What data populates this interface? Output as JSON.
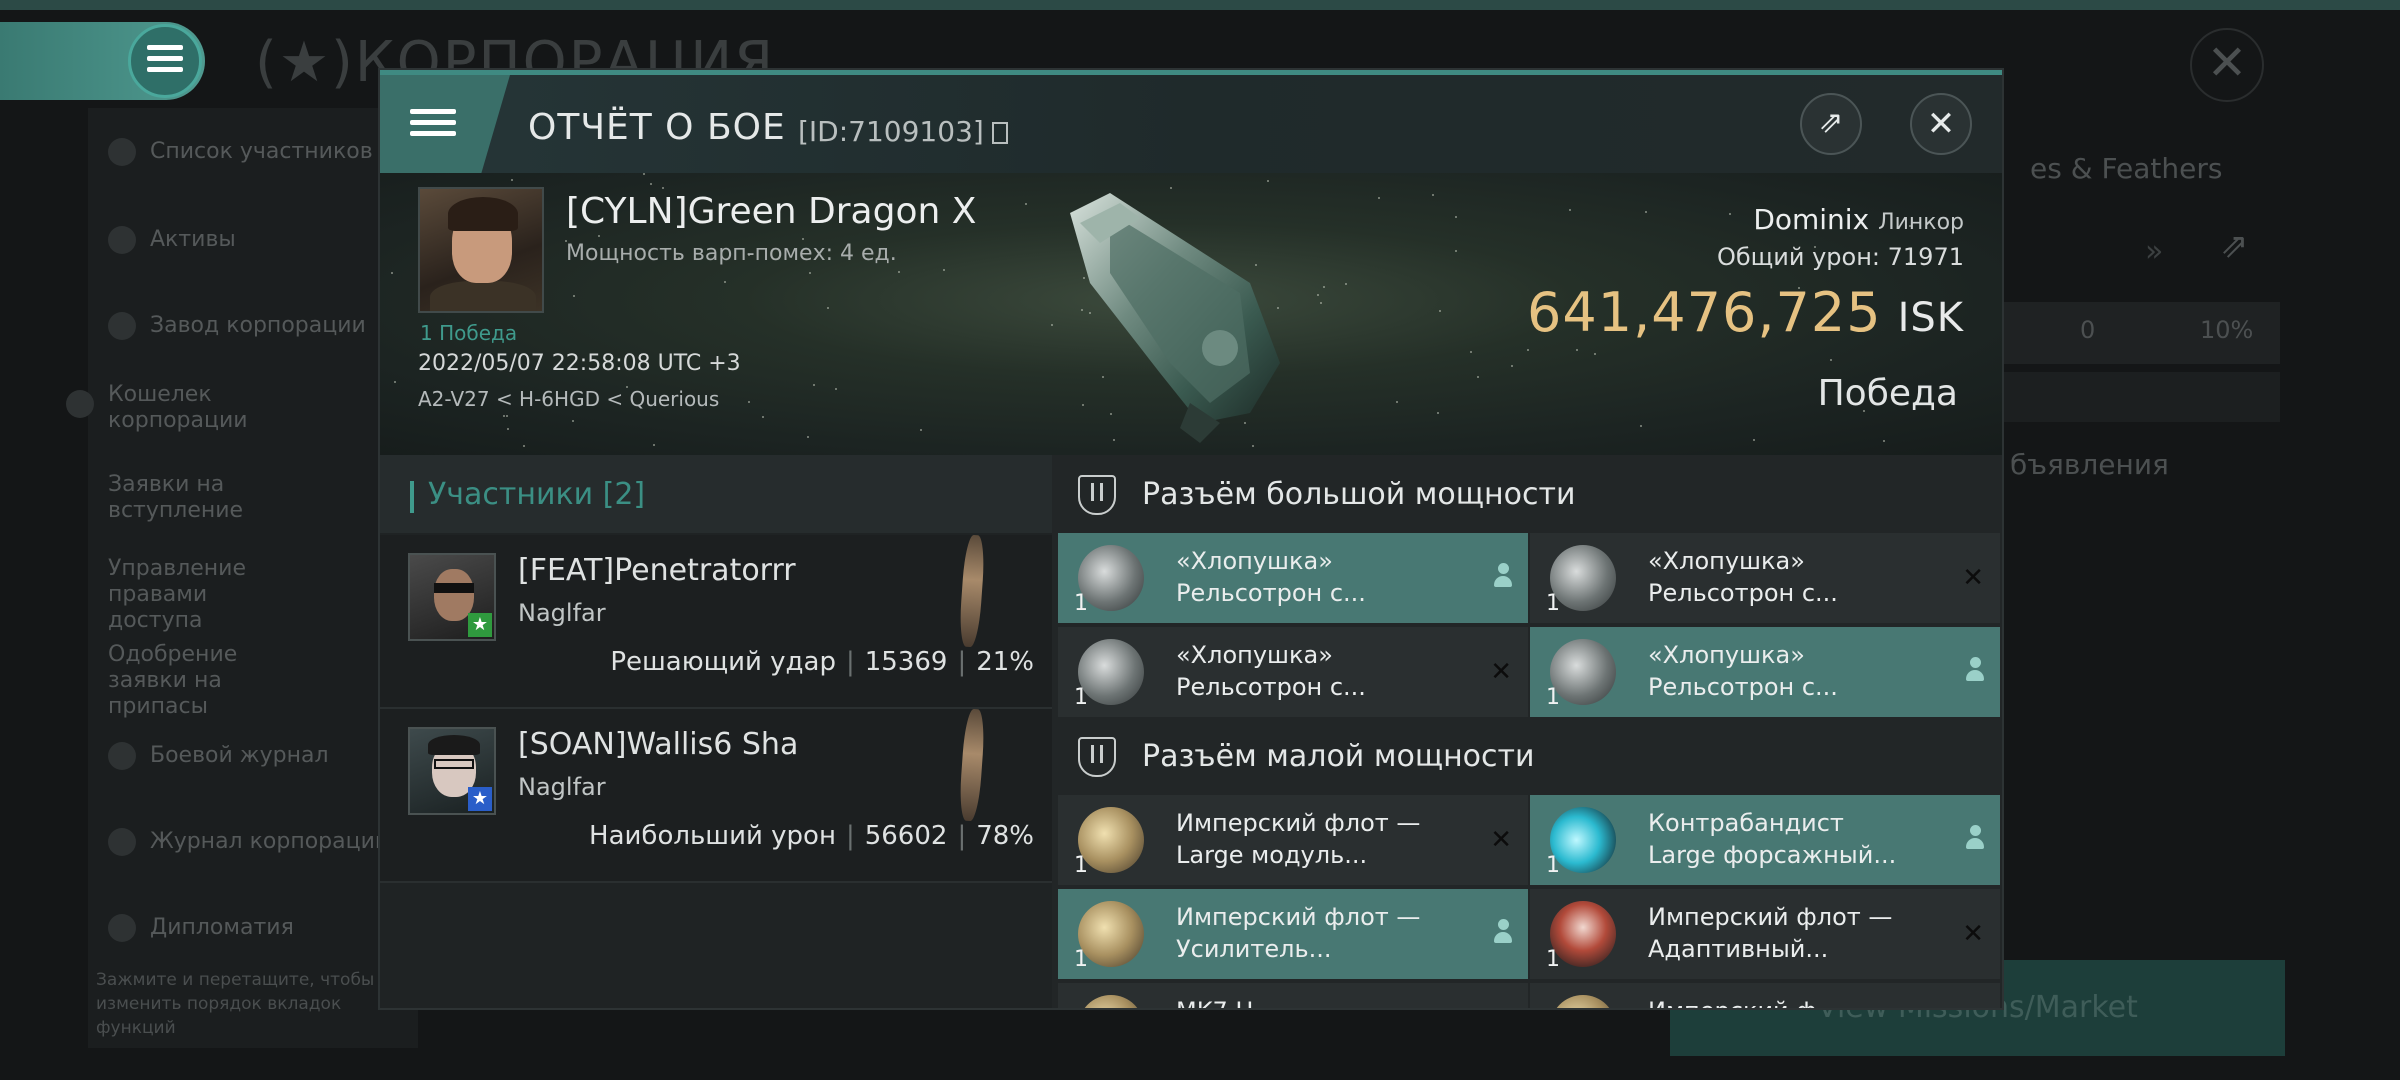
{
  "background": {
    "title": "КОРПОРАЦИЯ",
    "sidebar": [
      "Список участников",
      "Активы",
      "Завод корпорации",
      "Кошелек корпорации",
      "Заявки на вступление",
      "Управление правами доступа",
      "Одобрение заявки на припасы",
      "Боевой журнал",
      "Журнал корпорации",
      "Дипломатия"
    ],
    "hint": "Зажмите и перетащите, чтобы изменить порядок вкладок функций",
    "right_name": "es & Feathers",
    "stat_value": "0",
    "stat_percent": "10%",
    "announcements": "бъявления",
    "market_button": "View Missions/Market"
  },
  "report": {
    "title": "ОТЧЁТ О БОЕ",
    "id": "[ID:7109103]",
    "victim": {
      "name": "[CYLN]Green Dragon X",
      "warp": "Мощность варп-помех: 4 ед.",
      "wins": "1 Победа",
      "datetime": "2022/05/07 22:58:08 UTC +3",
      "system": "A2-V27 < H-6HGD < Querious"
    },
    "ship": {
      "name": "Dominix",
      "class": "Линкор",
      "total_damage_label": "Общий урон:",
      "total_damage": "71971",
      "isk_value": "641,476,725",
      "isk_unit": "ISK",
      "result": "Победа"
    }
  },
  "participants": {
    "header": "Участники [2]",
    "list": [
      {
        "name": "[FEAT]Penetratorrr",
        "ship": "Naglfar",
        "label": "Решающий удар",
        "damage": "15369",
        "percent": "21%",
        "badge": "★",
        "badge_color": "#2f9a3e"
      },
      {
        "name": "[SOAN]Wallis6 Sha",
        "ship": "Naglfar",
        "label": "Наибольший урон",
        "damage": "56602",
        "percent": "78%",
        "badge": "★",
        "badge_color": "#2a5ec9"
      }
    ]
  },
  "slots": {
    "high": {
      "title": "Разъём большой мощности",
      "modules": [
        {
          "qty": "1",
          "l1": "«Хлопушка»",
          "l2": "Рельсотрон с...",
          "status": "dropped"
        },
        {
          "qty": "1",
          "l1": "«Хлопушка»",
          "l2": "Рельсотрон с...",
          "status": "destroyed"
        },
        {
          "qty": "1",
          "l1": "«Хлопушка»",
          "l2": "Рельсотрон с...",
          "status": "destroyed"
        },
        {
          "qty": "1",
          "l1": "«Хлопушка»",
          "l2": "Рельсотрон с...",
          "status": "dropped"
        }
      ]
    },
    "low": {
      "title": "Разъём малой мощности",
      "modules": [
        {
          "qty": "1",
          "l1": "Имперский флот —",
          "l2": "Large модуль...",
          "status": "destroyed"
        },
        {
          "qty": "1",
          "l1": "Контрабандист",
          "l2": "Large форсажный...",
          "status": "dropped"
        },
        {
          "qty": "1",
          "l1": "Имперский флот —",
          "l2": "Усилитель...",
          "status": "dropped"
        },
        {
          "qty": "1",
          "l1": "Имперский флот —",
          "l2": "Адаптивный...",
          "status": "destroyed"
        }
      ],
      "partial": [
        "MK7 H",
        "Имперский ф"
      ]
    }
  },
  "colors": {
    "accent": "#3f9a8c",
    "isk": "#e6c282",
    "active_slot": "#487873"
  }
}
